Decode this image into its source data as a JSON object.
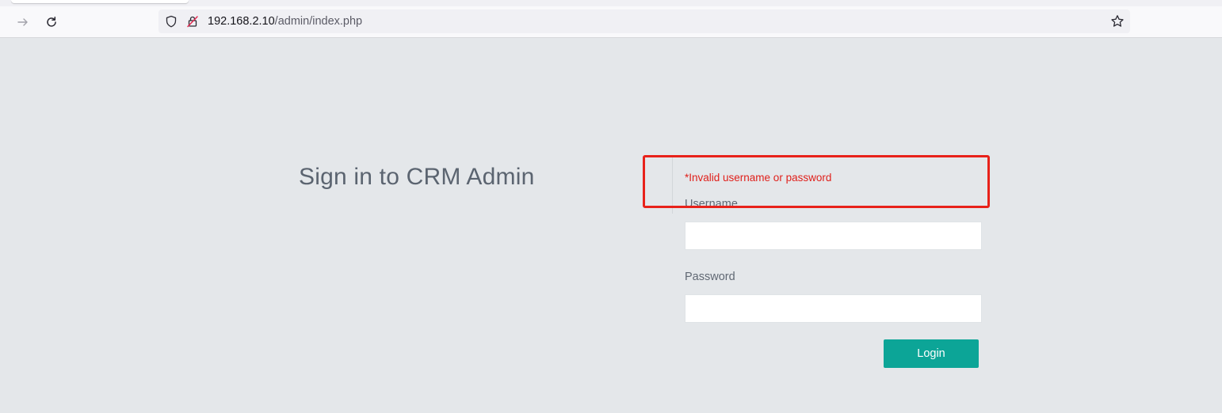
{
  "browser": {
    "url_host": "192.168.2.10",
    "url_path": "/admin/index.php",
    "icons": {
      "forward": "arrow-right-icon",
      "reload": "reload-icon",
      "tracking": "shield-icon",
      "insecure": "insecure-lock-icon",
      "bookmark": "star-icon"
    }
  },
  "page": {
    "title": "Sign in to CRM Admin",
    "error": "*Invalid username or password",
    "username_label": "Username",
    "username_value": "",
    "password_label": "Password",
    "password_value": "",
    "login_label": "Login"
  },
  "colors": {
    "background": "#e4e7ea",
    "accent": "#0ca597",
    "error": "#e0201b",
    "annotation": "#e8221a"
  }
}
